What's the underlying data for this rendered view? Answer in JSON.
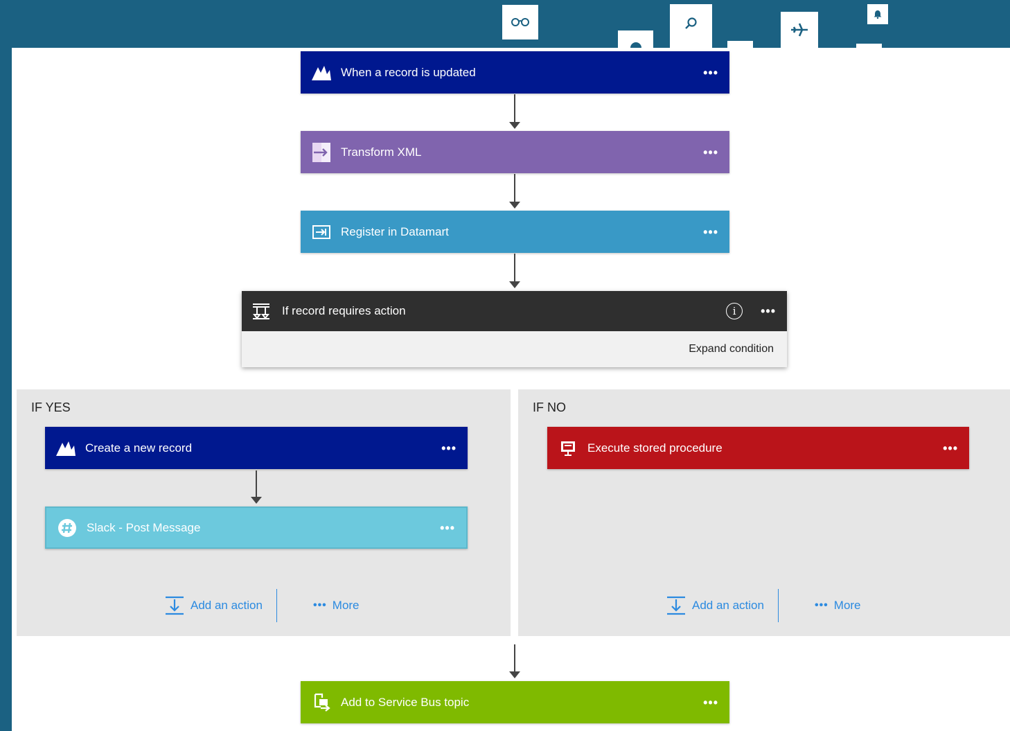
{
  "topbar": {
    "icons": [
      "glasses-icon",
      "gauge-icon",
      "search-icon",
      "blank-tile-icon",
      "airplane-icon",
      "bell-icon",
      "blank-tile-icon"
    ]
  },
  "flow": {
    "trigger": {
      "title": "When a record is updated",
      "icon": "dynamics-icon",
      "color": "#00188f",
      "more": "•••"
    },
    "transform": {
      "title": "Transform XML",
      "icon": "transform-xml-icon",
      "color": "#8064ae",
      "more": "•••"
    },
    "register": {
      "title": "Register in Datamart",
      "icon": "function-icon",
      "color": "#3999c6",
      "more": "•••"
    },
    "condition": {
      "title": "If record requires action",
      "info": "i",
      "more": "•••",
      "expand_label": "Expand condition",
      "color": "#2f2f2f"
    },
    "if_yes": {
      "label": "IF YES",
      "actions": [
        {
          "title": "Create a new record",
          "icon": "dynamics-icon",
          "color": "#00188f",
          "more": "•••"
        },
        {
          "title": "Slack - Post Message",
          "icon": "slack-icon",
          "color": "#6cc9dd",
          "more": "•••"
        }
      ],
      "add_action": "Add an action",
      "more_label": "More",
      "more_dots": "•••"
    },
    "if_no": {
      "label": "IF NO",
      "actions": [
        {
          "title": "Execute stored procedure",
          "icon": "sql-icon",
          "color": "#ba141a",
          "more": "•••"
        }
      ],
      "add_action": "Add an action",
      "more_label": "More",
      "more_dots": "•••"
    },
    "final": {
      "title": "Add to Service Bus topic",
      "icon": "service-bus-icon",
      "color": "#7fba00",
      "more": "•••"
    }
  },
  "colors": {
    "topbar": "#1b6182",
    "link": "#2b8ae0",
    "branch_bg": "#e6e6e6"
  }
}
